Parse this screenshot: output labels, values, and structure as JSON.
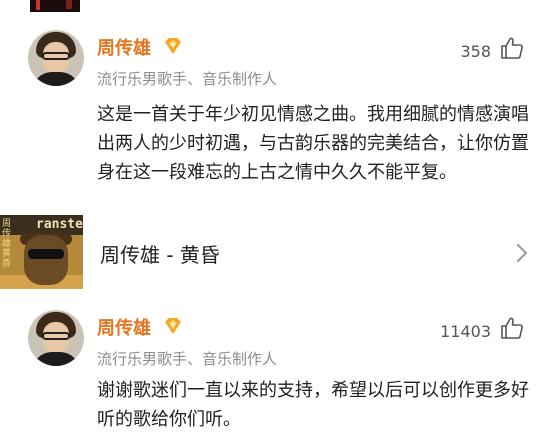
{
  "comments": [
    {
      "author": "周传雄",
      "subtitle": "流行乐男歌手、音乐制作人",
      "likes": "358",
      "text": "这是一首关于年少初见情感之曲。我用细腻的情感演唱出两人的少时初遇，与古韵乐器的完美结合，让你仿置身在这一段难忘的上古之情中久久不能平复。",
      "music_card": {
        "cover_title": "ranste",
        "cover_side_text": "周传雄黄昏",
        "song_title": "周传雄 - 黄昏"
      }
    },
    {
      "author": "周传雄",
      "subtitle": "流行乐男歌手、音乐制作人",
      "likes": "11403",
      "text": "谢谢歌迷们一直以来的支持，希望以后可以创作更多好听的歌给你们听。"
    }
  ],
  "colors": {
    "author_name": "#e5751f",
    "vip_badge": "#f5a623",
    "secondary_text": "#8c8c8c",
    "body_text": "#222222"
  },
  "icons": {
    "vip": "vip-badge-icon",
    "like": "thumbs-up-icon",
    "chevron": "chevron-right-icon"
  }
}
